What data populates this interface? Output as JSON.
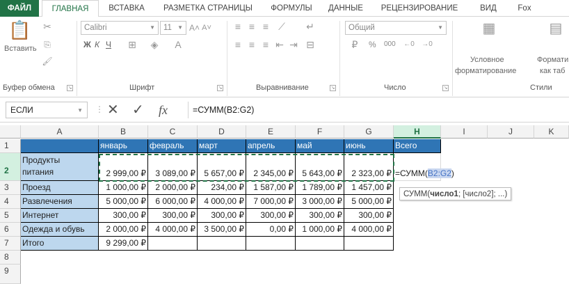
{
  "ribbon_tabs": [
    {
      "label": "ФАЙЛ"
    },
    {
      "label": "ГЛАВНАЯ"
    },
    {
      "label": "ВСТАВКА"
    },
    {
      "label": "РАЗМЕТКА СТРАНИЦЫ"
    },
    {
      "label": "ФОРМУЛЫ"
    },
    {
      "label": "ДАННЫЕ"
    },
    {
      "label": "РЕЦЕНЗИРОВАНИЕ"
    },
    {
      "label": "ВИД"
    },
    {
      "label": "Fox"
    }
  ],
  "ribbon": {
    "clipboard": {
      "paste_label": "Вставить",
      "group_label": "Буфер обмена"
    },
    "font": {
      "font_name": "Calibri",
      "font_size": "11",
      "bold": "Ж",
      "italic": "К",
      "underline": "Ч",
      "group_label": "Шрифт"
    },
    "alignment": {
      "group_label": "Выравнивание"
    },
    "number": {
      "format": "Общий",
      "percent": "%",
      "thousands": "000",
      "group_label": "Число"
    },
    "styles": {
      "conditional_line1": "Условное",
      "conditional_line2": "форматирование",
      "format_table_line1": "Формати",
      "format_table_line2": "как таб",
      "group_label": "Стили"
    }
  },
  "formula_bar": {
    "name_box": "ЕСЛИ",
    "cancel_icon": "✕",
    "enter_icon": "✓",
    "fx": "fx",
    "formula": "=СУММ(B2:G2)"
  },
  "columns": [
    "A",
    "B",
    "C",
    "D",
    "E",
    "F",
    "G",
    "H",
    "I",
    "J",
    "K"
  ],
  "rows": [
    "1",
    "2",
    "3",
    "4",
    "5",
    "6",
    "7",
    "8",
    "9"
  ],
  "table": {
    "header": [
      "",
      "январь",
      "февраль",
      "март",
      "апрель",
      "май",
      "июнь",
      "Всего"
    ],
    "row2_label_line1": "Продукты",
    "row2_label_line2": "питания",
    "row2_values": [
      "2 999,00 ₽",
      "3 089,00 ₽",
      "5 657,00 ₽",
      "2 345,00 ₽",
      "5 643,00 ₽",
      "2 323,00 ₽"
    ],
    "row2_edit_prefix": "=СУММ(",
    "row2_edit_ref": "B2:G2",
    "row2_edit_suffix": ")",
    "body": [
      {
        "label": "Проезд",
        "values": [
          "1 000,00 ₽",
          "2 000,00 ₽",
          "234,00 ₽",
          "1 587,00 ₽",
          "1 789,00 ₽",
          "1 457,00 ₽"
        ]
      },
      {
        "label": "Развлечения",
        "values": [
          "5 000,00 ₽",
          "6 000,00 ₽",
          "4 000,00 ₽",
          "7 000,00 ₽",
          "3 000,00 ₽",
          "5 000,00 ₽"
        ]
      },
      {
        "label": "Интернет",
        "values": [
          "300,00 ₽",
          "300,00 ₽",
          "300,00 ₽",
          "300,00 ₽",
          "300,00 ₽",
          "300,00 ₽"
        ]
      },
      {
        "label": "Одежда и обувь",
        "values": [
          "2 000,00 ₽",
          "4 000,00 ₽",
          "3 500,00 ₽",
          "0,00 ₽",
          "1 000,00 ₽",
          "4 000,00 ₽"
        ]
      },
      {
        "label": "Итого",
        "values": [
          "9 299,00 ₽",
          "",
          "",
          "",
          "",
          ""
        ]
      }
    ]
  },
  "tooltip": {
    "fn": "СУММ(",
    "arg1": "число1",
    "rest": "; [число2]; ...)"
  },
  "colors": {
    "accent": "#217346",
    "header_fill": "#2f75b5",
    "label_fill": "#bdd7ee"
  }
}
